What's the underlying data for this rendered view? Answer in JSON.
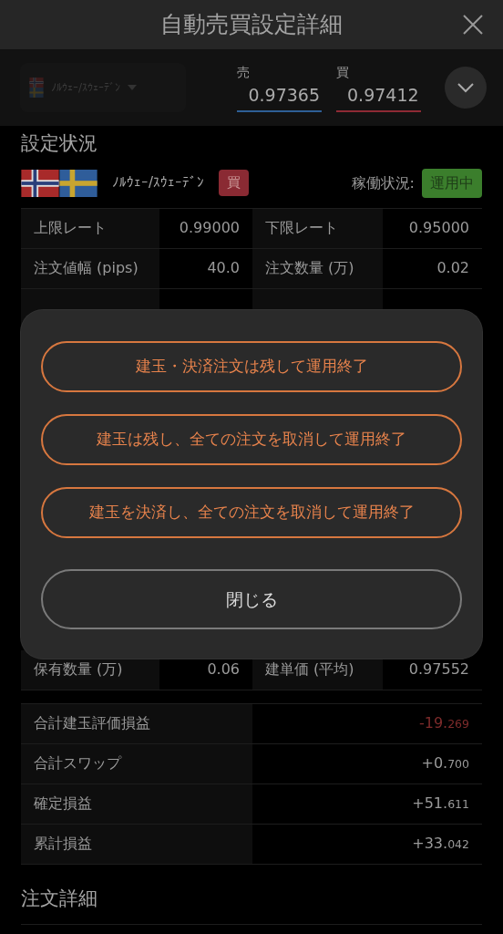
{
  "header": {
    "title": "自動売買設定詳細"
  },
  "rate_bar": {
    "pair": "ﾉﾙｳｪｰ/ｽｳｪｰﾃﾞﾝ",
    "sell": {
      "label": "売",
      "price": "0.97365"
    },
    "buy": {
      "label": "買",
      "price": "0.97412"
    }
  },
  "settings": {
    "heading": "設定状況",
    "pair": "ﾉﾙｳｪｰ/ｽｳｪｰﾃﾞﾝ",
    "side": "買",
    "status_label": "稼働状況:",
    "status": "運用中"
  },
  "settings_table": [
    {
      "label_1": "上限レート",
      "value_1": "0.99000",
      "label_2": "下限レート",
      "value_2": "0.95000"
    },
    {
      "label_1": "注文値幅 (pips)",
      "value_1": "40.0",
      "label_2": "注文数量 (万)",
      "value_2": "0.02"
    },
    {
      "label_1": "保有数量 (万)",
      "value_1": "0.06",
      "label_2": "建単価 (平均)",
      "value_2": "0.97552"
    }
  ],
  "summary": [
    {
      "label": "合計建玉評価損益",
      "main": "-19.",
      "fraction": "269",
      "negative": true
    },
    {
      "label": "合計スワップ",
      "main": "+0.",
      "fraction": "700",
      "negative": false
    },
    {
      "label": "確定損益",
      "main": "+51.",
      "fraction": "611",
      "negative": false
    },
    {
      "label": "累計損益",
      "main": "+33.",
      "fraction": "042",
      "negative": false
    }
  ],
  "order_heading": "注文詳細",
  "dialog": {
    "options": [
      "建玉・決済注文は残して運用終了",
      "建玉は残し、全ての注文を取消して運用終了",
      "建玉を決済し、全ての注文を取消して運用終了"
    ],
    "close": "閉じる"
  }
}
